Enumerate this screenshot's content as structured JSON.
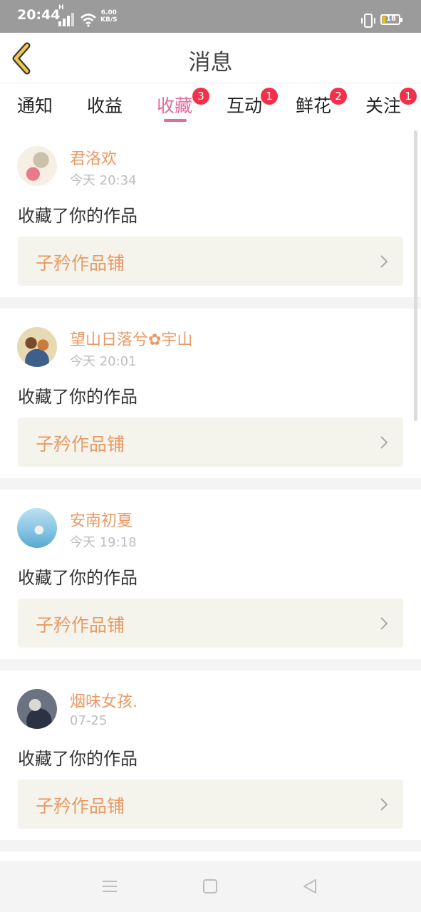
{
  "status_bar": {
    "time": "20:44",
    "network_type": "H",
    "speed_value": "6.00",
    "speed_unit": "KB/S",
    "battery_level": "18",
    "icons": [
      "signal-icon",
      "wifi-icon",
      "vibrate-icon",
      "battery-icon"
    ]
  },
  "header": {
    "title": "消息",
    "back_icon": "chevron-left-icon"
  },
  "tabs": [
    {
      "label": "通知",
      "badge": ""
    },
    {
      "label": "收益",
      "badge": ""
    },
    {
      "label": "收藏",
      "badge": "3",
      "active": true
    },
    {
      "label": "互动",
      "badge": "1"
    },
    {
      "label": "鲜花",
      "badge": "2"
    },
    {
      "label": "关注",
      "badge": "1"
    }
  ],
  "messages": [
    {
      "user": "君洛欢",
      "time": "今天 20:34",
      "action": "收藏了你的作品",
      "work": "子矜作品铺"
    },
    {
      "user": "望山日落兮✿宇山",
      "time": "今天 20:01",
      "action": "收藏了你的作品",
      "work": "子矜作品铺"
    },
    {
      "user": "安南初夏",
      "time": "今天 19:18",
      "action": "收藏了你的作品",
      "work": "子矜作品铺"
    },
    {
      "user": "烟味女孩.",
      "time": "07-25",
      "action": "收藏了你的作品",
      "work": "子矜作品铺"
    }
  ],
  "nav_bar": [
    "menu-icon",
    "home-square-icon",
    "back-triangle-icon"
  ],
  "colors": {
    "accent": "#e36a9d",
    "username": "#e89a65",
    "badge": "#f2304a",
    "work_box_bg": "#f5f4ec",
    "back_arrow": "#f3c74b"
  }
}
